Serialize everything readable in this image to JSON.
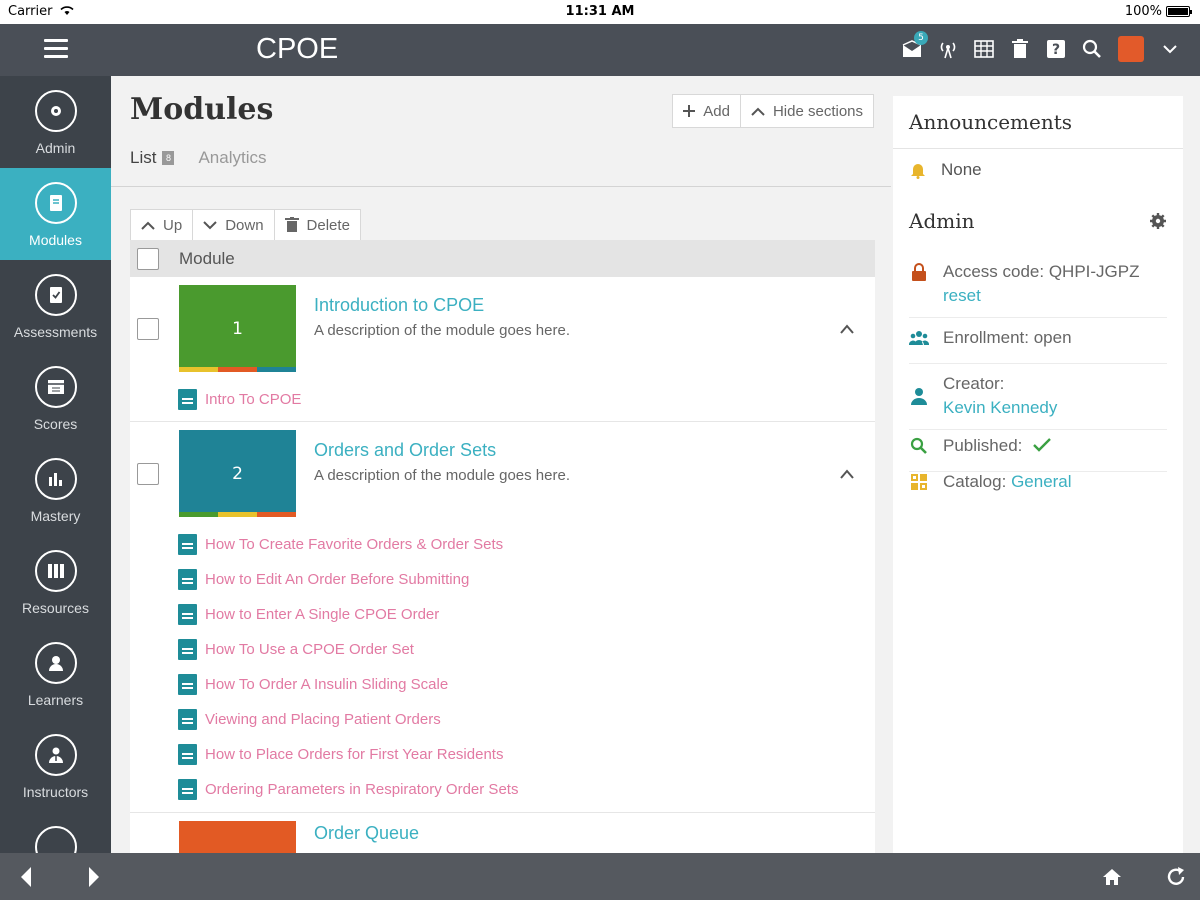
{
  "status_bar": {
    "carrier": "Carrier",
    "time": "11:31 AM",
    "battery": "100%"
  },
  "app": {
    "title": "CPOE",
    "notification_count": "5"
  },
  "sidebar": {
    "items": [
      {
        "label": "Admin",
        "icon": "gear-icon"
      },
      {
        "label": "Modules",
        "icon": "book-icon",
        "active": true
      },
      {
        "label": "Assessments",
        "icon": "checklist-icon"
      },
      {
        "label": "Scores",
        "icon": "calendar-icon"
      },
      {
        "label": "Mastery",
        "icon": "bar-chart-icon"
      },
      {
        "label": "Resources",
        "icon": "books-icon"
      },
      {
        "label": "Learners",
        "icon": "user-icon"
      },
      {
        "label": "Instructors",
        "icon": "instructor-icon"
      }
    ]
  },
  "main": {
    "title": "Modules",
    "add_label": "Add",
    "hide_sections_label": "Hide sections",
    "tabs": [
      {
        "label": "List",
        "count": "8"
      },
      {
        "label": "Analytics"
      }
    ],
    "toolbar": {
      "up": "Up",
      "down": "Down",
      "delete": "Delete"
    },
    "column_header": "Module",
    "modules": [
      {
        "number": "1",
        "title": "Introduction to CPOE",
        "description": "A description of the module goes here.",
        "color": "#4a9a2e",
        "sections": [
          "Intro To CPOE"
        ]
      },
      {
        "number": "2",
        "title": "Orders and Order Sets",
        "description": "A description of the module goes here.",
        "color": "#1f8396",
        "sections": [
          "How To Create Favorite Orders & Order Sets",
          "How to Edit An Order Before Submitting",
          "How to Enter A Single CPOE Order",
          "How To Use a CPOE Order Set",
          "How To Order A Insulin Sliding Scale",
          "Viewing and Placing Patient Orders",
          "How to Place Orders for First Year Residents",
          "Ordering Parameters in Respiratory Order Sets"
        ]
      },
      {
        "title": "Order Queue",
        "color": "#e25a24"
      }
    ]
  },
  "panel": {
    "announcements_title": "Announcements",
    "announcements_value": "None",
    "admin_title": "Admin",
    "access_code_label": "Access code: QHPI-JGPZ",
    "reset_label": "reset",
    "enrollment_label": "Enrollment: open",
    "creator_label": "Creator:",
    "creator_name": "Kevin Kennedy",
    "published_label": "Published:",
    "catalog_label": "Catalog:",
    "catalog_value": "General"
  },
  "colors": {
    "accent": "#3bb0c1",
    "section_link": "#e27aa3",
    "sidebar_bg": "#3d434a",
    "appbar_bg": "#4a4f57"
  }
}
